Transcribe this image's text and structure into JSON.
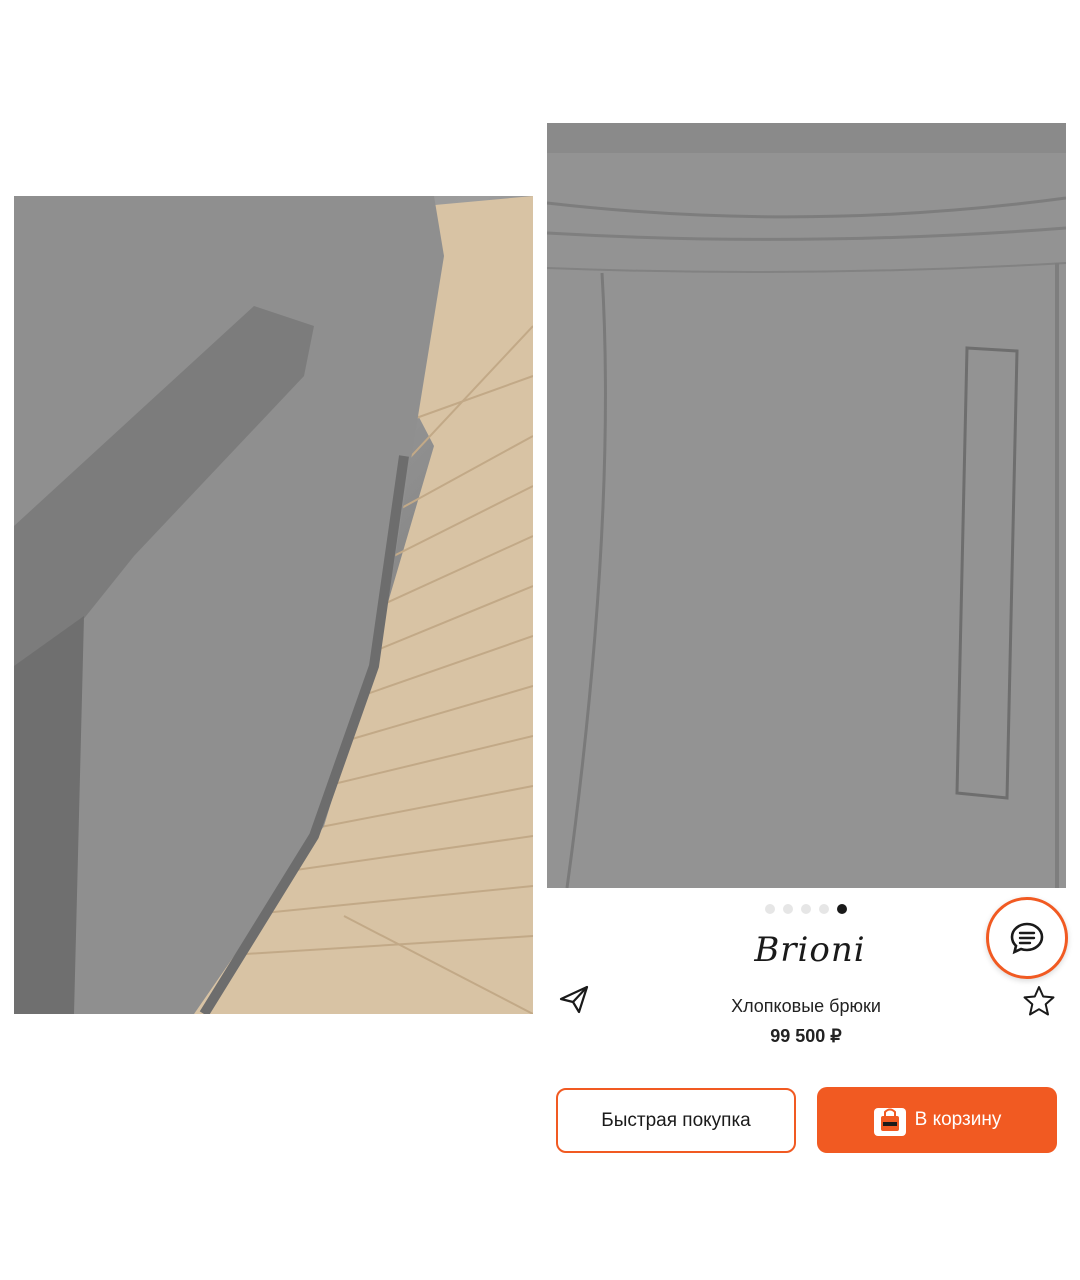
{
  "gallery": {
    "total_images": 5,
    "active_index": 4
  },
  "product": {
    "brand": "Brioni",
    "name": "Хлопковые брюки",
    "price": "99 500 ₽"
  },
  "actions": {
    "quick_buy_label": "Быстрая покупка",
    "add_to_cart_label": "В корзину"
  },
  "icons": {
    "share": "share-icon",
    "favorite": "star-icon",
    "chat": "chat-icon",
    "cart": "bag-icon"
  },
  "colors": {
    "accent": "#f15a22",
    "dot_active": "#1a1a1a",
    "dot_inactive": "#e6e6e6"
  }
}
